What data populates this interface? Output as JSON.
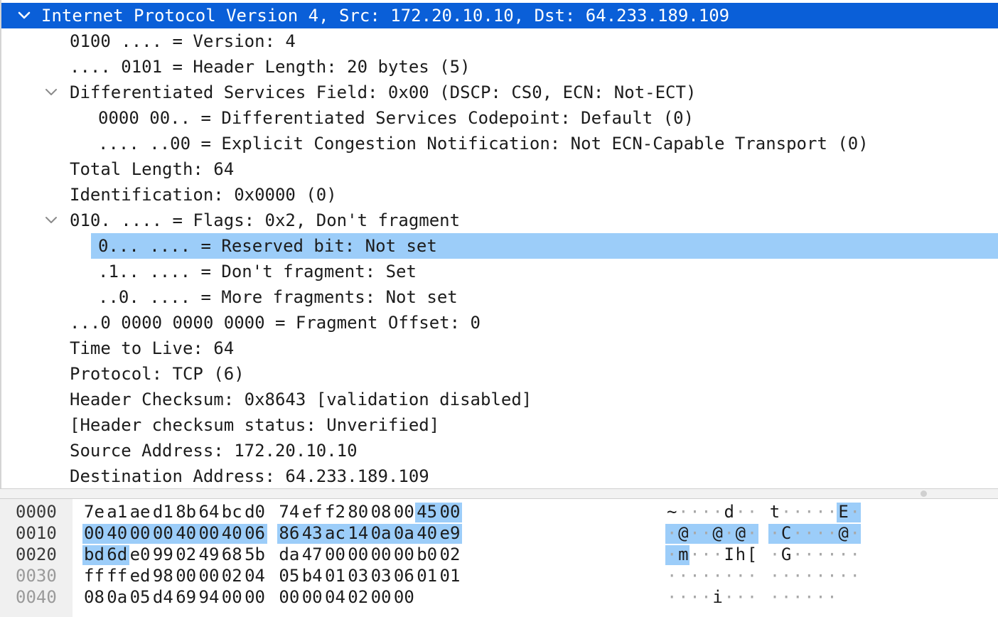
{
  "tree": {
    "rows": [
      {
        "text": "Internet Protocol Version 4, Src: 172.20.10.10, Dst: 64.233.189.109",
        "indent": 0,
        "expanded": true,
        "selected": true
      },
      {
        "text": "0100 .... = Version: 4",
        "indent": 1
      },
      {
        "text": ".... 0101 = Header Length: 20 bytes (5)",
        "indent": 1
      },
      {
        "text": "Differentiated Services Field: 0x00 (DSCP: CS0, ECN: Not-ECT)",
        "indent": 1,
        "expanded": true
      },
      {
        "text": "0000 00.. = Differentiated Services Codepoint: Default (0)",
        "indent": 2
      },
      {
        "text": ".... ..00 = Explicit Congestion Notification: Not ECN-Capable Transport (0)",
        "indent": 2
      },
      {
        "text": "Total Length: 64",
        "indent": 1
      },
      {
        "text": "Identification: 0x0000 (0)",
        "indent": 1
      },
      {
        "text": "010. .... = Flags: 0x2, Don't fragment",
        "indent": 1,
        "expanded": true
      },
      {
        "text": "0... .... = Reserved bit: Not set",
        "indent": 2,
        "highlighted": true
      },
      {
        "text": ".1.. .... = Don't fragment: Set",
        "indent": 2
      },
      {
        "text": "..0. .... = More fragments: Not set",
        "indent": 2
      },
      {
        "text": "...0 0000 0000 0000 = Fragment Offset: 0",
        "indent": 1
      },
      {
        "text": "Time to Live: 64",
        "indent": 1
      },
      {
        "text": "Protocol: TCP (6)",
        "indent": 1
      },
      {
        "text": "Header Checksum: 0x8643 [validation disabled]",
        "indent": 1
      },
      {
        "text": "[Header checksum status: Unverified]",
        "indent": 1
      },
      {
        "text": "Source Address: 172.20.10.10",
        "indent": 1
      },
      {
        "text": "Destination Address: 64.233.189.109",
        "indent": 1
      }
    ]
  },
  "hex": {
    "rows": [
      {
        "offset": "0000",
        "dim": false,
        "bytes": [
          "7e",
          "a1",
          "ae",
          "d1",
          "8b",
          "64",
          "bc",
          "d0",
          "74",
          "ef",
          "f2",
          "80",
          "08",
          "00",
          "45",
          "00"
        ],
        "ascii": [
          "~",
          "·",
          "·",
          "·",
          "·",
          "d",
          "·",
          "·",
          "t",
          "·",
          "·",
          "·",
          "·",
          "·",
          "E",
          "·"
        ]
      },
      {
        "offset": "0010",
        "dim": false,
        "bytes": [
          "00",
          "40",
          "00",
          "00",
          "40",
          "00",
          "40",
          "06",
          "86",
          "43",
          "ac",
          "14",
          "0a",
          "0a",
          "40",
          "e9"
        ],
        "ascii": [
          "·",
          "@",
          "·",
          "·",
          "@",
          "·",
          "@",
          "·",
          "·",
          "C",
          "·",
          "·",
          "·",
          "·",
          "@",
          "·"
        ]
      },
      {
        "offset": "0020",
        "dim": false,
        "bytes": [
          "bd",
          "6d",
          "e0",
          "99",
          "02",
          "49",
          "68",
          "5b",
          "da",
          "47",
          "00",
          "00",
          "00",
          "00",
          "b0",
          "02"
        ],
        "ascii": [
          "·",
          "m",
          "·",
          "·",
          "·",
          "I",
          "h",
          "[",
          "·",
          "G",
          "·",
          "·",
          "·",
          "·",
          "·",
          "·"
        ]
      },
      {
        "offset": "0030",
        "dim": true,
        "bytes": [
          "ff",
          "ff",
          "ed",
          "98",
          "00",
          "00",
          "02",
          "04",
          "05",
          "b4",
          "01",
          "03",
          "03",
          "06",
          "01",
          "01"
        ],
        "ascii": [
          "·",
          "·",
          "·",
          "·",
          "·",
          "·",
          "·",
          "·",
          "·",
          "·",
          "·",
          "·",
          "·",
          "·",
          "·",
          "·"
        ]
      },
      {
        "offset": "0040",
        "dim": true,
        "bytes": [
          "08",
          "0a",
          "05",
          "d4",
          "69",
          "94",
          "00",
          "00",
          "00",
          "00",
          "04",
          "02",
          "00",
          "00"
        ],
        "ascii": [
          "·",
          "·",
          "·",
          "·",
          "i",
          "·",
          "·",
          "·",
          "·",
          "·",
          "·",
          "·",
          "·",
          "·"
        ]
      }
    ],
    "selection_bytes": [
      14,
      33
    ],
    "colors": {
      "selection": "#9ccdf9",
      "primary_selection": "#0a5fd8",
      "gutter": "#f0f0f0"
    }
  },
  "icons": {
    "expanded": "chevron-down-icon",
    "pane_grip": "grip-dot-icon"
  }
}
